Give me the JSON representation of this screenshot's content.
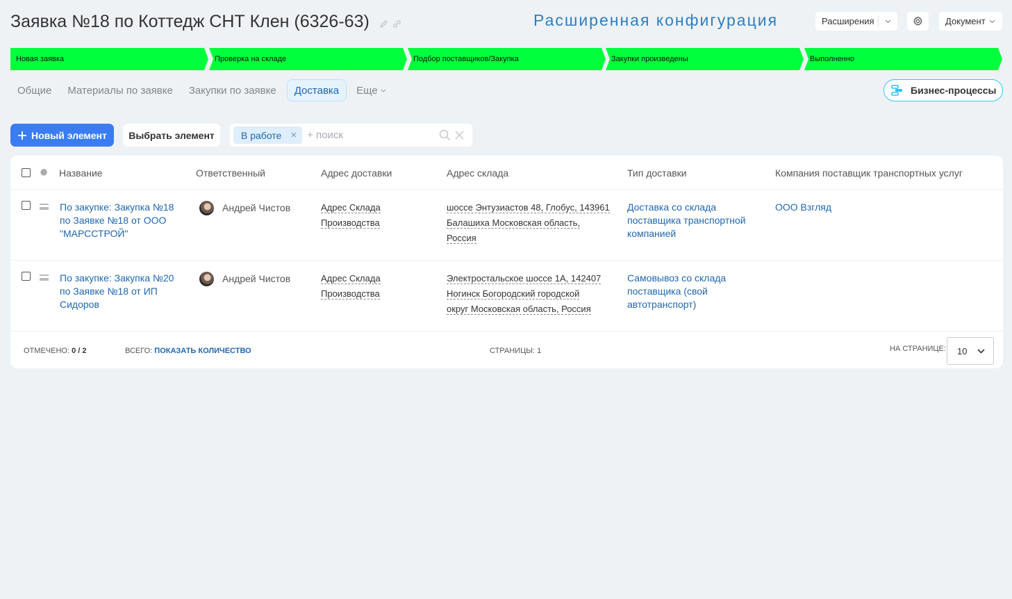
{
  "header": {
    "title": "Заявка №18 по Коттедж СНТ Клен (6326-63)",
    "config_label": "Расширенная конфигурация",
    "extensions_label": "Расширения",
    "document_label": "Документ"
  },
  "stages": [
    {
      "label": "Новая заявка"
    },
    {
      "label": "Проверка на складе"
    },
    {
      "label": "Подбор поставщиков/Закупка"
    },
    {
      "label": "Закупки произведены"
    },
    {
      "label": "Выполненно"
    }
  ],
  "stage_color": "#00ff3c",
  "tabs": [
    {
      "label": "Общие",
      "active": false
    },
    {
      "label": "Материалы по заявке",
      "active": false
    },
    {
      "label": "Закупки по заявке",
      "active": false
    },
    {
      "label": "Доставка",
      "active": true
    },
    {
      "label": "Еще",
      "active": false
    }
  ],
  "business_process_label": "Бизнес-процессы",
  "toolbar": {
    "new_label": "Новый элемент",
    "select_label": "Выбрать элемент",
    "filter_chip": "В работе",
    "search_placeholder": "+ поиск"
  },
  "table": {
    "columns": [
      "Название",
      "Ответственный",
      "Адрес доставки",
      "Адрес склада",
      "Тип доставки",
      "Компания поставщик транспортных услуг"
    ],
    "rows": [
      {
        "name": [
          "По закупке: Закупка №18",
          "по Заявке №18 от ООО",
          "\"МАРССТРОЙ\""
        ],
        "responsible": "Андрей Чистов",
        "delivery_address": [
          "Адрес Склада",
          "Производства"
        ],
        "warehouse_address": [
          "шоссе Энтузиастов 48, Глобус, 143961",
          "Балашиха Московская область,",
          "Россия"
        ],
        "delivery_type": [
          "Доставка со склада",
          "поставщика транспортной",
          "компанией"
        ],
        "transport_company": "ООО Взгляд"
      },
      {
        "name": [
          "По закупке: Закупка №20",
          "по Заявке №18 от ИП",
          "Сидоров"
        ],
        "responsible": "Андрей Чистов",
        "delivery_address": [
          "Адрес Склада",
          "Производства"
        ],
        "warehouse_address": [
          "Электростальское шоссе 1А, 142407",
          "Ногинск Богородский городской",
          "округ Московская область, Россия"
        ],
        "delivery_type": [
          "Самовывоз со склада",
          "поставщика (свой",
          "автотранспорт)"
        ],
        "transport_company": ""
      }
    ]
  },
  "footer": {
    "marked_label": "Отмечено:",
    "marked_value": "0 / 2",
    "total_label": "Всего:",
    "total_link": "Показать количество",
    "pages_label": "Страницы:",
    "pages_value": "1",
    "per_page_label": "На странице:",
    "per_page_value": "10"
  },
  "colors": {
    "accent": "#3b7cf3",
    "link": "#2067b0",
    "config_label": "#2d7fc1",
    "bp_border": "#2fc6f6"
  }
}
